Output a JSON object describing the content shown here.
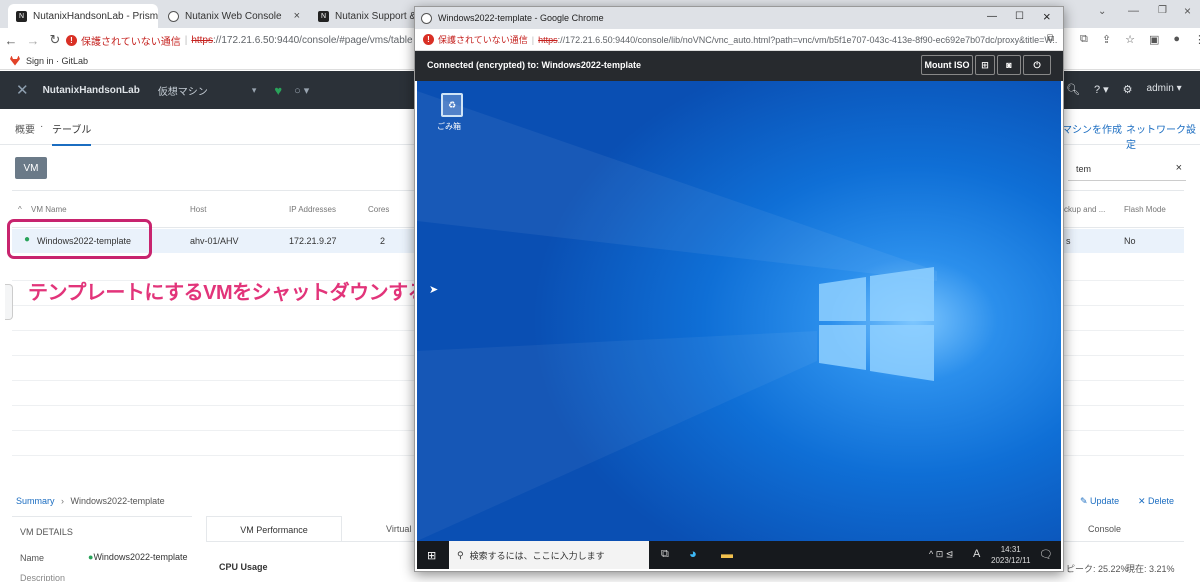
{
  "browser": {
    "tabs": [
      {
        "title": "NutanixHandsonLab - Prism Ele",
        "active": true
      },
      {
        "title": "Nutanix Web Console",
        "active": false
      },
      {
        "title": "Nutanix Support & Insight",
        "active": false
      }
    ],
    "url_warning": "保護されていない通信",
    "url_scheme": "https",
    "url_rest": "://172.21.6.50:9440/console/#page/vms/table",
    "bookmark": "Sign in · GitLab"
  },
  "prism": {
    "cluster_name": "NutanixHandsonLab",
    "section": "仮想マシン",
    "user": "admin",
    "subnav": {
      "overview": "概要",
      "separator": "·",
      "table": "テーブル"
    },
    "actions": {
      "create_vm": "マシンを作成",
      "network_settings": "ネットワーク設定"
    },
    "filter_button": "VM",
    "search_value": "tem",
    "clear": "×",
    "columns": [
      "VM Name",
      "Host",
      "IP Addresses",
      "Cores",
      "ckup and ...",
      "Flash Mode"
    ],
    "row": {
      "name": "Windows2022-template",
      "host": "ahv-01/AHV",
      "ip": "172.21.9.27",
      "cores": "2",
      "backup": "s",
      "flash": "No"
    },
    "breadcrumb": {
      "root": "Summary",
      "sep": "›",
      "item": "Windows2022-template"
    },
    "update": "Update",
    "delete": "Delete",
    "vm_details": "VM DETAILS",
    "details_name_label": "Name",
    "details_name_value": "Windows2022-template",
    "details_next_label": "Description",
    "perf_tab": "VM Performance",
    "virtual_tab": "Virtual",
    "console_tab": "Console",
    "cpu_usage": "CPU Usage",
    "peak": "ピーク: 25.22%",
    "current": "現在: 3.21%"
  },
  "annotation": "テンプレートにするVMをシャットダウンする",
  "vnc": {
    "window_title": "Windows2022-template - Google Chrome",
    "url_warning": "保護されていない通信",
    "url_scheme": "https",
    "url_rest": "://172.21.6.50:9440/console/lib/noVNC/vnc_auto.html?path=vnc/vm/b5f1e707-043c-413e-8f90-ec692e7b07dc/proxy&title=W...",
    "status": "Connected (encrypted) to: Windows2022-template",
    "mount_iso": "Mount ISO",
    "recycle_bin": "ごみ箱",
    "search_placeholder": "検索するには、ここに入力します",
    "ime": "A",
    "time": "14:31",
    "date": "2023/12/11"
  },
  "colors": {
    "prism_nav": "#2b3138",
    "accent": "#1b6dc1",
    "annotation": "#e2347a",
    "highlight": "#c8246e",
    "status_green": "#29a35a"
  }
}
